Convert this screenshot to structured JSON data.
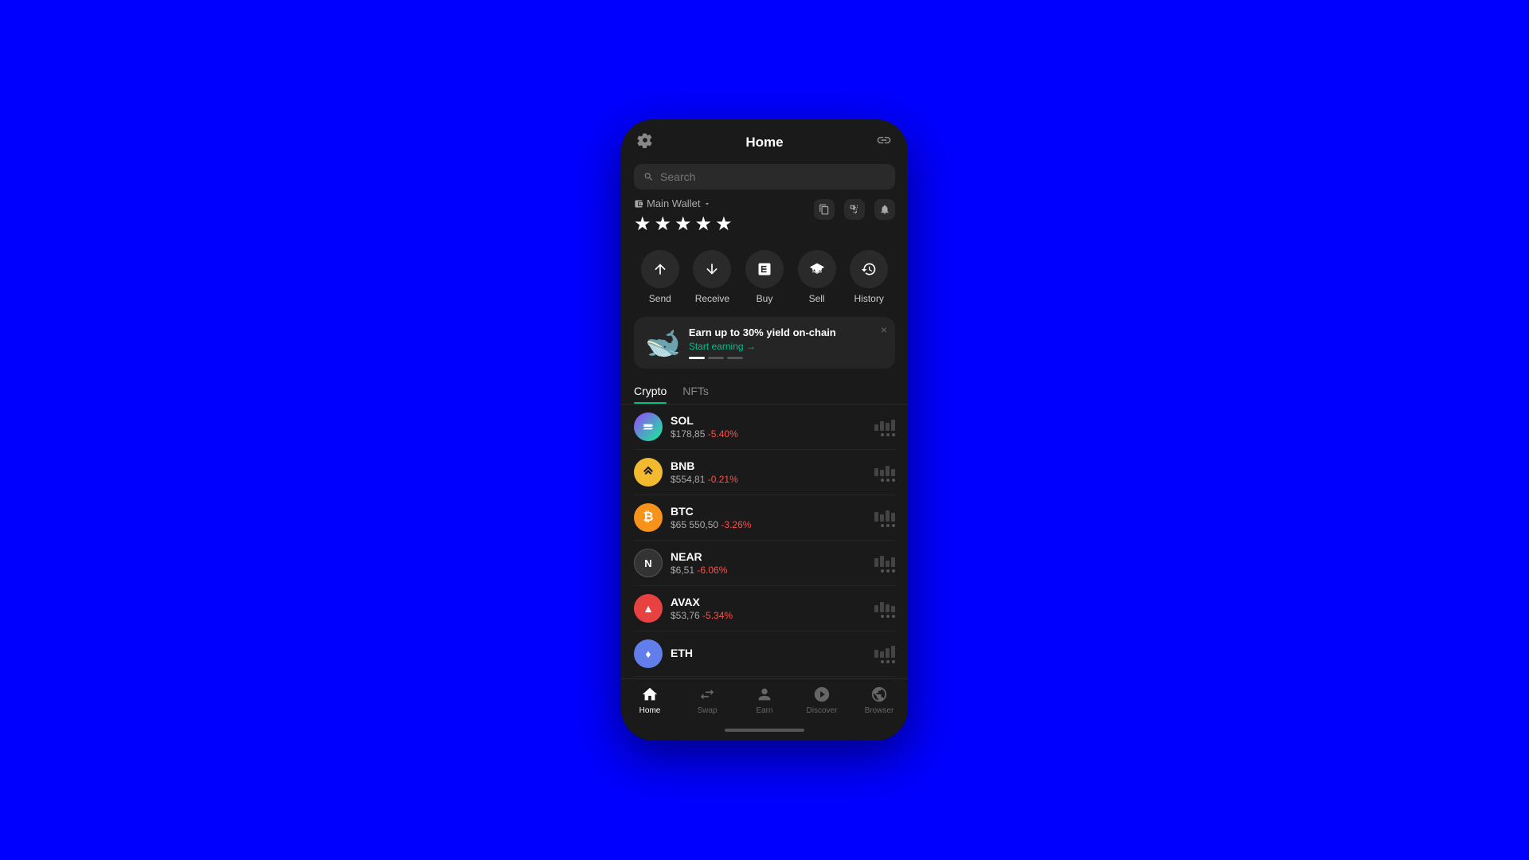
{
  "header": {
    "title": "Home",
    "settings_icon": "⚙",
    "link_icon": "🔗"
  },
  "search": {
    "placeholder": "Search"
  },
  "wallet": {
    "name": "Main Wallet",
    "balance_masked": "★★★★★",
    "copy_icon": "⧉",
    "scan_icon": "⊡",
    "bell_icon": "🔔"
  },
  "actions": [
    {
      "id": "send",
      "label": "Send",
      "icon": "↑"
    },
    {
      "id": "receive",
      "label": "Receive",
      "icon": "↓"
    },
    {
      "id": "buy",
      "label": "Buy",
      "icon": "≡"
    },
    {
      "id": "sell",
      "label": "Sell",
      "icon": "🏛"
    },
    {
      "id": "history",
      "label": "History",
      "icon": "⏱"
    }
  ],
  "promo": {
    "title": "Earn up to 30% yield on-chain",
    "cta": "Start earning →",
    "close": "×",
    "dots": [
      {
        "active": true
      },
      {
        "active": false
      },
      {
        "active": false
      }
    ]
  },
  "tabs": [
    {
      "id": "crypto",
      "label": "Crypto",
      "active": true
    },
    {
      "id": "nfts",
      "label": "NFTs",
      "active": false
    }
  ],
  "crypto_list": [
    {
      "id": "sol",
      "symbol": "SOL",
      "price": "$178,85",
      "change": "-5.40%",
      "icon_color": "sol",
      "icon_text": "◎"
    },
    {
      "id": "bnb",
      "symbol": "BNB",
      "price": "$554,81",
      "change": "-0.21%",
      "icon_color": "bnb",
      "icon_text": "BNB"
    },
    {
      "id": "btc",
      "symbol": "BTC",
      "price": "$65 550,50",
      "change": "-3.26%",
      "icon_color": "btc",
      "icon_text": "₿"
    },
    {
      "id": "near",
      "symbol": "NEAR",
      "price": "$6,51",
      "change": "-6.06%",
      "icon_color": "near",
      "icon_text": "N"
    },
    {
      "id": "avax",
      "symbol": "AVAX",
      "price": "$53,76",
      "change": "-5.34%",
      "icon_color": "avax",
      "icon_text": "▲"
    },
    {
      "id": "eth",
      "symbol": "ETH",
      "price": "",
      "change": "",
      "icon_color": "eth",
      "icon_text": "♦"
    }
  ],
  "bottom_nav": [
    {
      "id": "home",
      "label": "Home",
      "icon": "⌂",
      "active": true
    },
    {
      "id": "swap",
      "label": "Swap",
      "icon": "⇄",
      "active": false
    },
    {
      "id": "earn",
      "label": "Earn",
      "icon": "👤",
      "active": false
    },
    {
      "id": "discover",
      "label": "Discover",
      "icon": "◎",
      "active": false
    },
    {
      "id": "browser",
      "label": "Browser",
      "icon": "⊙",
      "active": false
    }
  ]
}
